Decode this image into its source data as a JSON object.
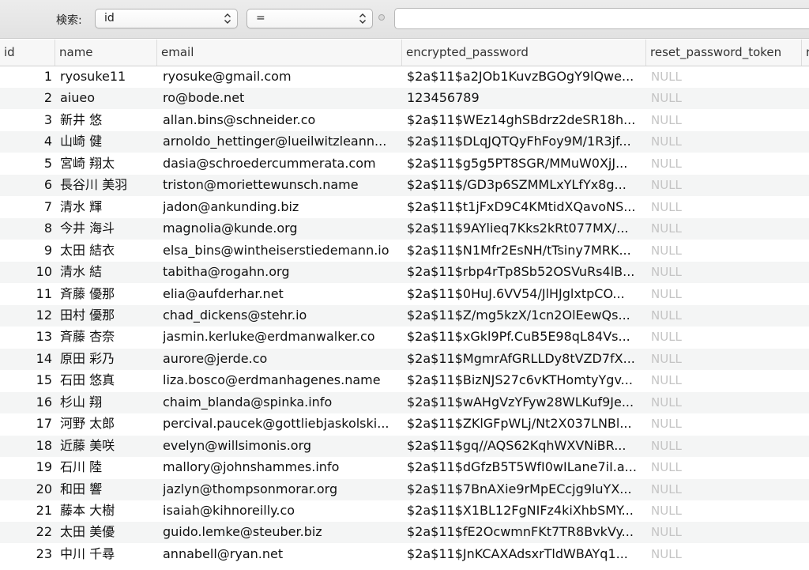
{
  "filter": {
    "label": "検索:",
    "field": "id",
    "operator": "=",
    "value": ""
  },
  "columns": [
    "id",
    "name",
    "email",
    "encrypted_password",
    "reset_password_token",
    "r"
  ],
  "rows": [
    {
      "id": "1",
      "name": "ryosuke11",
      "email": "ryosuke@gmail.com",
      "encrypted_password": "$2a$11$a2JOb1KuvzBGOgY9lQwe...",
      "reset_password_token": "NULL"
    },
    {
      "id": "2",
      "name": "aiueo",
      "email": "ro@bode.net",
      "encrypted_password": "123456789",
      "reset_password_token": "NULL"
    },
    {
      "id": "3",
      "name": "新井 悠",
      "email": "allan.bins@schneider.co",
      "encrypted_password": "$2a$11$WEz14ghSBdrz2deSR18h...",
      "reset_password_token": "NULL"
    },
    {
      "id": "4",
      "name": "山崎 健",
      "email": "arnoldo_hettinger@lueilwitzleann...",
      "encrypted_password": "$2a$11$DLqJQTQyFhFoy9M/1R3jf...",
      "reset_password_token": "NULL"
    },
    {
      "id": "5",
      "name": "宮崎 翔太",
      "email": "dasia@schroedercummerata.com",
      "encrypted_password": "$2a$11$g5g5PT8SGR/MMuW0XjJ...",
      "reset_password_token": "NULL"
    },
    {
      "id": "6",
      "name": "長谷川 美羽",
      "email": "triston@moriettewunsch.name",
      "encrypted_password": "$2a$11$/GD3p6SZMMLxYLfYx8g...",
      "reset_password_token": "NULL"
    },
    {
      "id": "7",
      "name": "清水 輝",
      "email": "jadon@ankunding.biz",
      "encrypted_password": "$2a$11$t1jFxD9C4KMtidXQavoNS...",
      "reset_password_token": "NULL"
    },
    {
      "id": "8",
      "name": "今井 海斗",
      "email": "magnolia@kunde.org",
      "encrypted_password": "$2a$11$9AYlieq7Kks2kRt077MX/...",
      "reset_password_token": "NULL"
    },
    {
      "id": "9",
      "name": "太田 結衣",
      "email": "elsa_bins@wintheiserstiedemann.io",
      "encrypted_password": "$2a$11$N1Mfr2EsNH/tTsiny7MRK...",
      "reset_password_token": "NULL"
    },
    {
      "id": "10",
      "name": "清水 結",
      "email": "tabitha@rogahn.org",
      "encrypted_password": "$2a$11$rbp4rTp8Sb52OSVuRs4lB...",
      "reset_password_token": "NULL"
    },
    {
      "id": "11",
      "name": "斉藤 優那",
      "email": "elia@aufderhar.net",
      "encrypted_password": "$2a$11$0HuJ.6VV54/JlHJglxtpCO...",
      "reset_password_token": "NULL"
    },
    {
      "id": "12",
      "name": "田村 優那",
      "email": "chad_dickens@stehr.io",
      "encrypted_password": "$2a$11$Z/mg5kzX/1cn2OlEewQs...",
      "reset_password_token": "NULL"
    },
    {
      "id": "13",
      "name": "斉藤 杏奈",
      "email": "jasmin.kerluke@erdmanwalker.co",
      "encrypted_password": "$2a$11$xGkl9Pf.CuB5E98qL84Vs...",
      "reset_password_token": "NULL"
    },
    {
      "id": "14",
      "name": "原田 彩乃",
      "email": "aurore@jerde.co",
      "encrypted_password": "$2a$11$MgmrAfGRLLDy8tVZD7fX...",
      "reset_password_token": "NULL"
    },
    {
      "id": "15",
      "name": "石田 悠真",
      "email": "liza.bosco@erdmanhagenes.name",
      "encrypted_password": "$2a$11$BizNJS27c6vKTHomtyYgv...",
      "reset_password_token": "NULL"
    },
    {
      "id": "16",
      "name": "杉山 翔",
      "email": "chaim_blanda@spinka.info",
      "encrypted_password": "$2a$11$wAHgVzYFyw28WLKuf9Je...",
      "reset_password_token": "NULL"
    },
    {
      "id": "17",
      "name": "河野 太郎",
      "email": "percival.paucek@gottliebjaskolski...",
      "encrypted_password": "$2a$11$ZKlGFpWLj/Nt2X037LNBl...",
      "reset_password_token": "NULL"
    },
    {
      "id": "18",
      "name": "近藤 美咲",
      "email": "evelyn@willsimonis.org",
      "encrypted_password": "$2a$11$gq//AQS62KqhWXVNiBR...",
      "reset_password_token": "NULL"
    },
    {
      "id": "19",
      "name": "石川 陸",
      "email": "mallory@johnshammes.info",
      "encrypted_password": "$2a$11$dGfzB5T5WfI0wILane7iI.a...",
      "reset_password_token": "NULL"
    },
    {
      "id": "20",
      "name": "和田 響",
      "email": "jazlyn@thompsonmorar.org",
      "encrypted_password": "$2a$11$7BnAXie9rMpECcjg9luYX...",
      "reset_password_token": "NULL"
    },
    {
      "id": "21",
      "name": "藤本 大樹",
      "email": "isaiah@kihnoreilly.co",
      "encrypted_password": "$2a$11$X1BL12FgNIFz4kiXhbSMY...",
      "reset_password_token": "NULL"
    },
    {
      "id": "22",
      "name": "太田 美優",
      "email": "guido.lemke@steuber.biz",
      "encrypted_password": "$2a$11$fE2OcwmnFKt7TR8BvkVy...",
      "reset_password_token": "NULL"
    },
    {
      "id": "23",
      "name": "中川 千尋",
      "email": "annabell@ryan.net",
      "encrypted_password": "$2a$11$JnKCAXAdsxrTldWBAYq1...",
      "reset_password_token": "NULL"
    }
  ]
}
